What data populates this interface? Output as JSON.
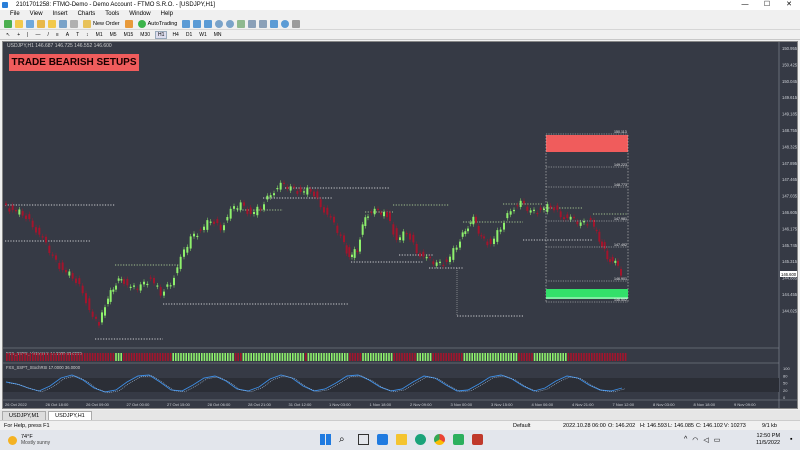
{
  "window": {
    "title": "2101701258: FTMO-Demo - Demo Account - FTMO S.R.O. - [USDJPY,H1]",
    "minimize": "—",
    "maximize": "☐",
    "close": "✕"
  },
  "menu": [
    "File",
    "View",
    "Insert",
    "Charts",
    "Tools",
    "Window",
    "Help"
  ],
  "toolbar": {
    "new_order": "New Order",
    "autotrading": "AutoTrading",
    "timeframes": [
      "M1",
      "M5",
      "M15",
      "M30",
      "H1",
      "H4",
      "D1",
      "W1",
      "MN"
    ]
  },
  "chart": {
    "header": "USDJPY,H1  146.687 146.725 146.552 146.600",
    "banner": "TRADE BEARISH SETUPS",
    "price_axis": [
      "150.955",
      "150.425",
      "150.045",
      "149.615",
      "149.185",
      "148.755",
      "148.325",
      "147.895",
      "147.465",
      "147.035",
      "146.605",
      "146.175",
      "145.745",
      "145.315",
      "144.885",
      "144.455",
      "144.025"
    ],
    "current_price": "146.600",
    "zone_labels": [
      "150.113",
      "149.223",
      "148.773",
      "147.981",
      "147.492",
      "146.901",
      "146.502"
    ],
    "indicator1_label": "FXS_SSPS_Histogram 14.0000 30.0000",
    "indicator2_label": "FXS_SSPT_StochRSI 17.0000 36.0000",
    "indicator2_axis": [
      "100",
      "80",
      "50",
      "20",
      "0"
    ],
    "time_axis": [
      "26 Oct 2022",
      "26 Oct 18:00",
      "26 Oct 09:00",
      "27 Oct 00:00",
      "27 Oct 15:00",
      "28 Oct 06:00",
      "28 Oct 21:00",
      "31 Oct 12:00",
      "1 Nov 03:00",
      "1 Nov 18:00",
      "2 Nov 09:00",
      "3 Nov 00:00",
      "3 Nov 15:00",
      "4 Nov 06:00",
      "4 Nov 21:00",
      "7 Nov 12:00",
      "8 Nov 03:00",
      "8 Nov 18:00",
      "9 Nov 09:00"
    ]
  },
  "tabs": [
    "USDJPY,M1",
    "USDJPY,H1"
  ],
  "status": {
    "help": "For Help, press F1",
    "profile": "Default",
    "datetime": "2022.10.28 06:00",
    "open": "O: 146.202",
    "high": "H: 146.593",
    "low": "L: 146.085",
    "close": "C: 146.102",
    "volume": "V: 10273",
    "traffic": "9/1 kb"
  },
  "taskbar": {
    "weather_temp": "74°F",
    "weather_desc": "Mostly sunny",
    "time": "12:50 PM",
    "date": "11/5/2022"
  }
}
